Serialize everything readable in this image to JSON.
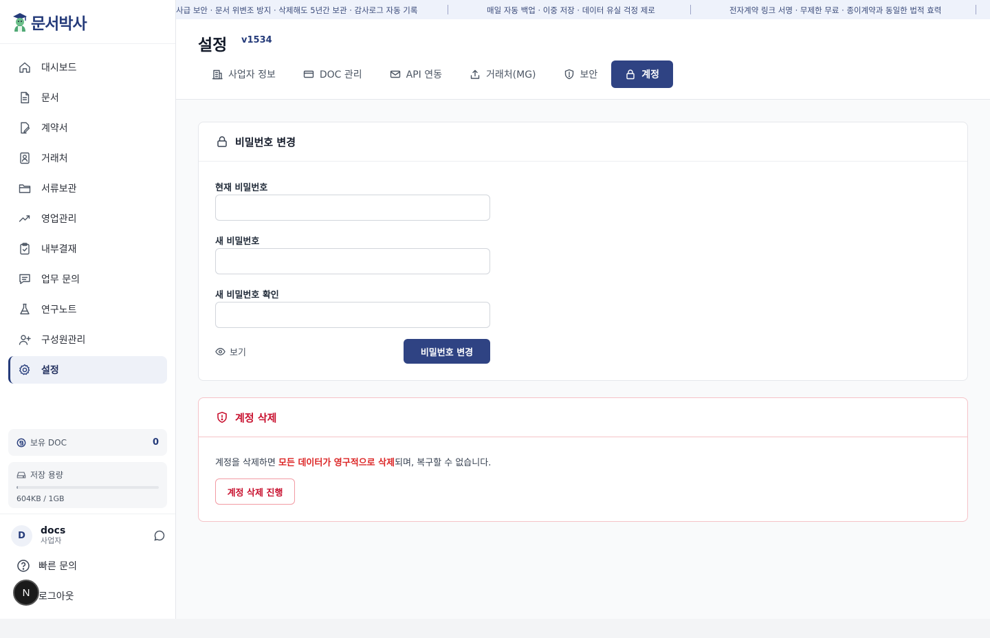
{
  "brand": {
    "name": "문서박사"
  },
  "ticker": {
    "items": [
      "사급 보안 · 문서 위변조 방지 · 삭제해도 5년간 보관 · 감사로그 자동 기록",
      "매일 자동 백업 · 이중 저장 · 데이터 유실 걱정 제로",
      "전자계약 링크 서명 · 무제한 무료 · 종이계약과 동일한 법적 효력"
    ]
  },
  "sidebar": {
    "items": [
      {
        "label": "대시보드",
        "icon": "home-icon"
      },
      {
        "label": "문서",
        "icon": "document-icon"
      },
      {
        "label": "계약서",
        "icon": "contract-icon"
      },
      {
        "label": "거래처",
        "icon": "contact-icon"
      },
      {
        "label": "서류보관",
        "icon": "folder-icon"
      },
      {
        "label": "영업관리",
        "icon": "trend-icon"
      },
      {
        "label": "내부결재",
        "icon": "clipboard-check-icon"
      },
      {
        "label": "업무 문의",
        "icon": "message-icon"
      },
      {
        "label": "연구노트",
        "icon": "flask-icon"
      },
      {
        "label": "구성원관리",
        "icon": "user-plus-icon"
      },
      {
        "label": "설정",
        "icon": "gear-icon",
        "active": true
      }
    ],
    "doc": {
      "label": "보유 DOC",
      "count": "0"
    },
    "storage": {
      "label": "저장 용량",
      "value": "604KB / 1GB",
      "used_fraction": 0.0006
    },
    "user": {
      "initial": "D",
      "name": "docs",
      "role": "사업자"
    },
    "quick_label": "빠른 문의",
    "logout_label": "로그아웃",
    "badge": "N"
  },
  "header": {
    "title": "설정",
    "version": "v1534",
    "tabs": [
      {
        "label": "사업자 정보",
        "icon": "building-icon"
      },
      {
        "label": "DOC 관리",
        "icon": "card-icon"
      },
      {
        "label": "API 연동",
        "icon": "mail-icon"
      },
      {
        "label": "거래처(MG)",
        "icon": "upload-icon"
      },
      {
        "label": "보안",
        "icon": "shield-icon"
      },
      {
        "label": "계정",
        "icon": "lock-icon",
        "active": true
      }
    ]
  },
  "password": {
    "title": "비밀번호 변경",
    "current_label": "현재 비밀번호",
    "current_value": "",
    "new_label": "새 비밀번호",
    "new_value": "",
    "confirm_label": "새 비밀번호 확인",
    "confirm_value": "",
    "show_label": "보기",
    "submit_label": "비밀번호 변경"
  },
  "delete": {
    "title": "계정 삭제",
    "text_before": "계정을 삭제하면 ",
    "text_bold": "모든 데이터가 영구적으로 삭제",
    "text_after": "되며, 복구할 수 없습니다.",
    "button_label": "계정 삭제 진행"
  },
  "colors": {
    "primary": "#2f4383",
    "danger": "#c8102e",
    "accent_bg": "#eef1f8"
  }
}
